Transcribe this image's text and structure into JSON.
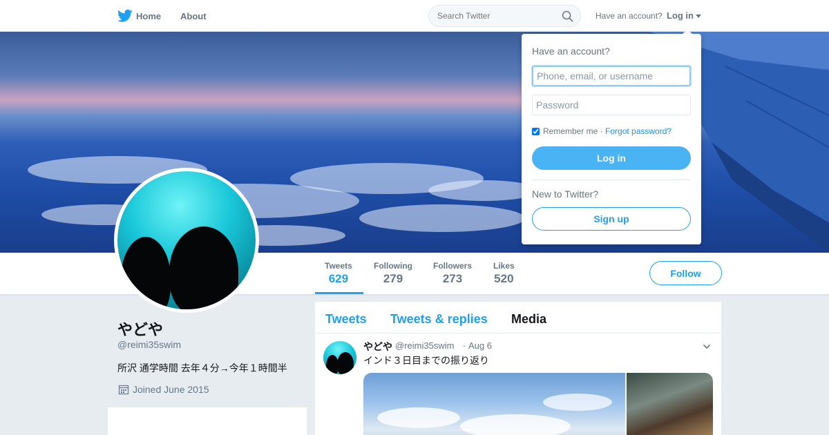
{
  "topbar": {
    "logo_icon": "twitter-bird-icon",
    "home_label": "Home",
    "about_label": "About",
    "search_placeholder": "Search Twitter",
    "have_account_label": "Have an account?",
    "login_label": "Log in",
    "brand_color": "#1da1f2"
  },
  "profile": {
    "name": "やどや",
    "handle": "@reimi35swim",
    "bio": "所沢 通学時間 去年４分→今年１時間半",
    "joined": "Joined June 2015"
  },
  "stats": [
    {
      "label": "Tweets",
      "value": "629",
      "active": true
    },
    {
      "label": "Following",
      "value": "279",
      "active": false
    },
    {
      "label": "Followers",
      "value": "273",
      "active": false
    },
    {
      "label": "Likes",
      "value": "520",
      "active": false
    }
  ],
  "follow_label": "Follow",
  "timeline": {
    "tabs": [
      {
        "label": "Tweets",
        "active": false
      },
      {
        "label": "Tweets & replies",
        "active": false
      },
      {
        "label": "Media",
        "active": true
      }
    ],
    "tweet": {
      "name": "やどや",
      "handle": "@reimi35swim",
      "separator": "·",
      "date": "Aug 6",
      "text": "インド３日目までの振り返り"
    }
  },
  "login_dropdown": {
    "title": "Have an account?",
    "username_placeholder": "Phone, email, or username",
    "password_placeholder": "Password",
    "remember_label": "Remember me",
    "separator": " · ",
    "forgot_label": "Forgot password?",
    "login_button": "Log in",
    "new_label": "New to Twitter?",
    "signup_button": "Sign up"
  }
}
